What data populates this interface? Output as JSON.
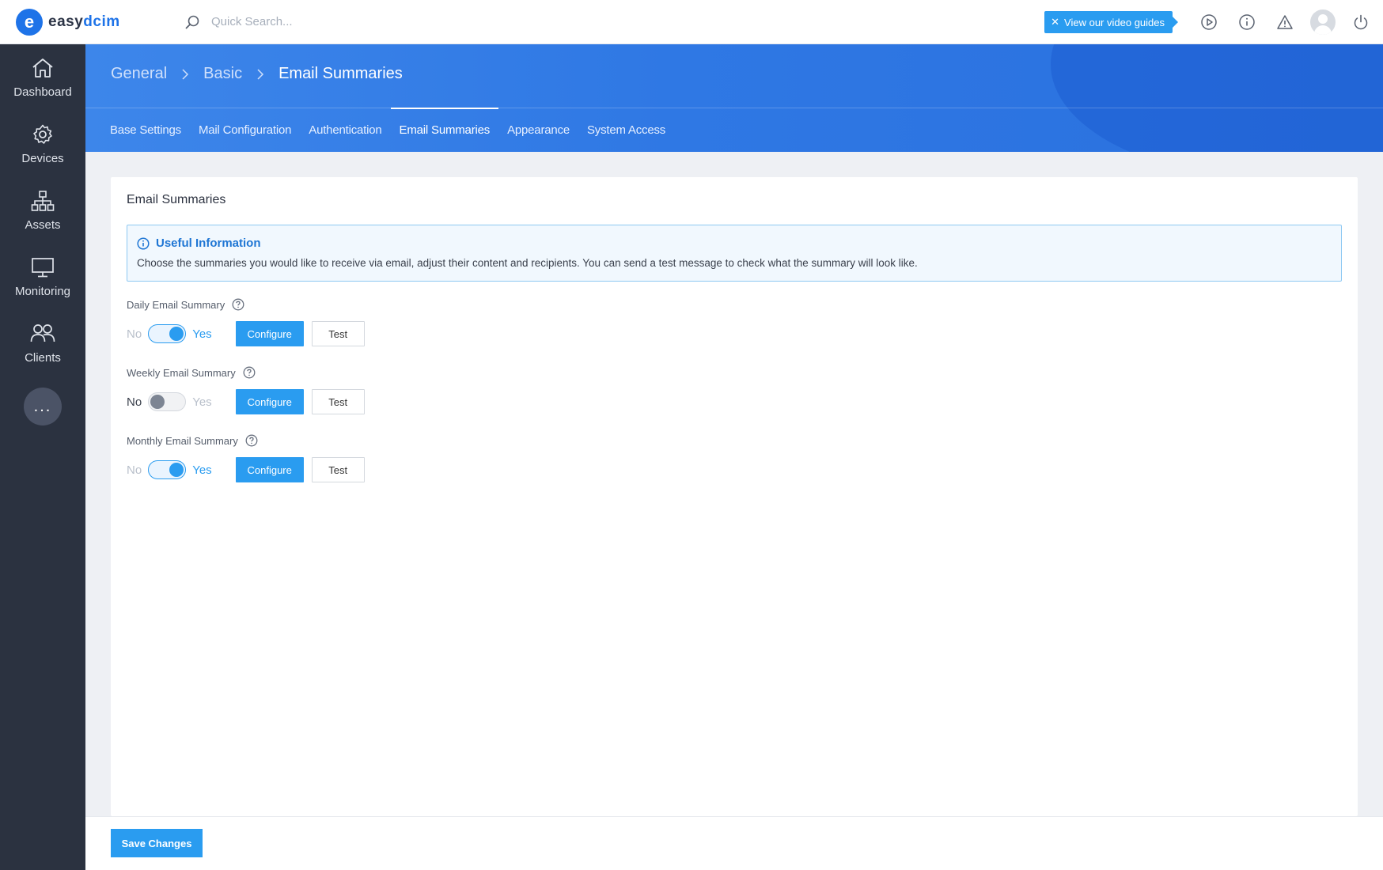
{
  "app": {
    "logo_letter": "e",
    "logo_text_a": "easy",
    "logo_text_b": "dcim",
    "brand_color": "#1e73e8",
    "accent_color": "#2a9cf0"
  },
  "search": {
    "placeholder": "Quick Search..."
  },
  "topbar": {
    "guides_label": "View our video guides",
    "icons": [
      "play-icon",
      "info-icon",
      "alert-icon",
      "avatar",
      "power-icon"
    ]
  },
  "sidebar": {
    "items": [
      {
        "label": "Dashboard",
        "icon": "home-icon"
      },
      {
        "label": "Devices",
        "icon": "gear-icon"
      },
      {
        "label": "Assets",
        "icon": "hierarchy-icon"
      },
      {
        "label": "Monitoring",
        "icon": "monitor-icon"
      },
      {
        "label": "Clients",
        "icon": "users-icon"
      }
    ],
    "more_label": "..."
  },
  "breadcrumb": [
    "General",
    "Basic",
    "Email Summaries"
  ],
  "tabs": [
    {
      "label": "Base Settings",
      "active": false
    },
    {
      "label": "Mail Configuration",
      "active": false
    },
    {
      "label": "Authentication",
      "active": false
    },
    {
      "label": "Email Summaries",
      "active": true
    },
    {
      "label": "Appearance",
      "active": false
    },
    {
      "label": "System Access",
      "active": false
    }
  ],
  "card": {
    "title": "Email Summaries",
    "info": {
      "title": "Useful Information",
      "text": "Choose the summaries you would like to receive via email, adjust their content and recipients. You can send a test message to check what the summary will look like."
    },
    "settings": [
      {
        "label": "Daily Email Summary",
        "enabled": true,
        "no_label": "No",
        "yes_label": "Yes",
        "configure_label": "Configure",
        "test_label": "Test"
      },
      {
        "label": "Weekly Email Summary",
        "enabled": false,
        "no_label": "No",
        "yes_label": "Yes",
        "configure_label": "Configure",
        "test_label": "Test"
      },
      {
        "label": "Monthly Email Summary",
        "enabled": true,
        "no_label": "No",
        "yes_label": "Yes",
        "configure_label": "Configure",
        "test_label": "Test"
      }
    ]
  },
  "footer": {
    "save_label": "Save Changes"
  }
}
